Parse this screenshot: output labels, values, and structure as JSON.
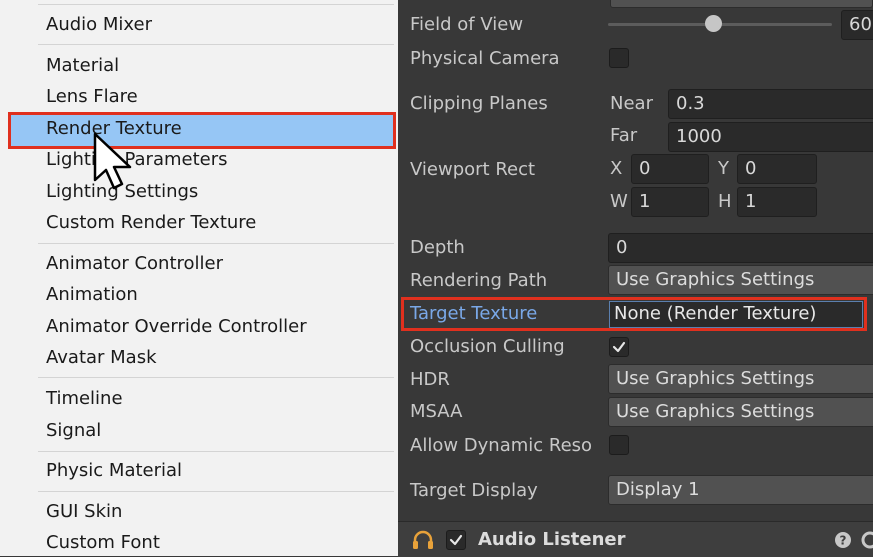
{
  "menu": {
    "items": [
      "Audio Mixer",
      "Material",
      "Lens Flare",
      "Render Texture",
      "Lighting Parameters",
      "Lighting Settings",
      "Custom Render Texture",
      "Animator Controller",
      "Animation",
      "Animator Override Controller",
      "Avatar Mask",
      "Timeline",
      "Signal",
      "Physic Material",
      "GUI Skin",
      "Custom Font"
    ]
  },
  "inspector": {
    "field_of_view": {
      "label": "Field of View",
      "value": "60",
      "slider_fraction": 0.47
    },
    "physical_camera": {
      "label": "Physical Camera",
      "checked": false
    },
    "clipping_planes": {
      "label": "Clipping Planes",
      "near_label": "Near",
      "near": "0.3",
      "far_label": "Far",
      "far": "1000"
    },
    "viewport_rect": {
      "label": "Viewport Rect",
      "x_label": "X",
      "x": "0",
      "y_label": "Y",
      "y": "0",
      "w_label": "W",
      "w": "1",
      "h_label": "H",
      "h": "1"
    },
    "depth": {
      "label": "Depth",
      "value": "0"
    },
    "rendering_path": {
      "label": "Rendering Path",
      "value": "Use Graphics Settings"
    },
    "target_texture": {
      "label": "Target Texture",
      "value": "None (Render Texture)"
    },
    "occlusion_culling": {
      "label": "Occlusion Culling",
      "checked": true
    },
    "hdr": {
      "label": "HDR",
      "value": "Use Graphics Settings"
    },
    "msaa": {
      "label": "MSAA",
      "value": "Use Graphics Settings"
    },
    "allow_dynamic_reso": {
      "label": "Allow Dynamic Reso",
      "checked": false
    },
    "target_display": {
      "label": "Target Display",
      "value": "Display 1"
    }
  },
  "footer": {
    "component_title": "Audio Listener",
    "enabled": true
  },
  "colors": {
    "highlight_border": "#e0301e",
    "selection": "#96c6f5",
    "link_label": "#7aa8e8"
  }
}
